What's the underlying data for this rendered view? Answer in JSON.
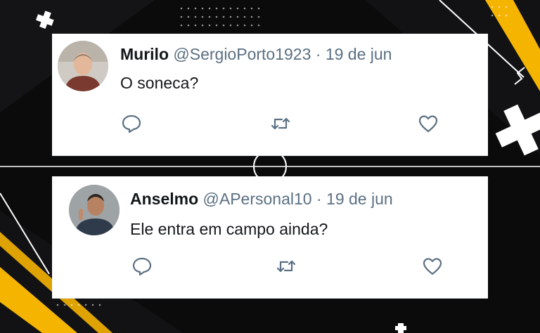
{
  "tweets": [
    {
      "name": "Murilo",
      "handle": "@SergioPorto1923",
      "separator": "·",
      "date": "19 de jun",
      "text": "O soneca?"
    },
    {
      "name": "Anselmo",
      "handle": "@APersonal10",
      "separator": "·",
      "date": "19 de jun",
      "text": "Ele entra em campo ainda?"
    }
  ],
  "icons": {
    "reply": "reply-icon",
    "retweet": "retweet-icon",
    "like": "heart-icon"
  },
  "colors": {
    "background": "#0b0b0c",
    "accent": "#f5b400",
    "muted_text": "#5b7083",
    "text": "#14171a"
  }
}
